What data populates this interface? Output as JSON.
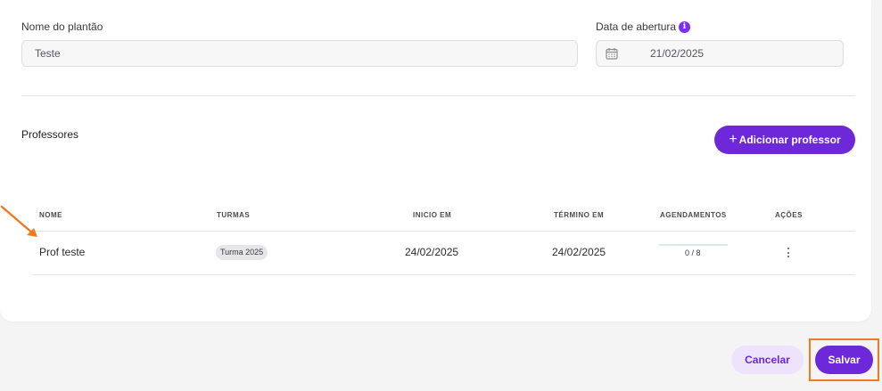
{
  "form": {
    "name_label": "Nome do plantão",
    "name_value": "Teste",
    "date_label": "Data de abertura",
    "date_info_icon": "i",
    "date_value": "21/02/2025"
  },
  "professors": {
    "section_title": "Professores",
    "add_button_icon": "+",
    "add_button_label": "Adicionar professor",
    "columns": [
      "NOME",
      "TURMAS",
      "INICIO EM",
      "TÉRMINO EM",
      "AGENDAMENTOS",
      "AÇÕES"
    ],
    "rows": [
      {
        "name": "Prof teste",
        "turma": "Turma 2025",
        "inicio": "24/02/2025",
        "termino": "24/02/2025",
        "agendamentos": "0 / 8",
        "agendamentos_fraction": 0
      }
    ]
  },
  "footer": {
    "cancel_label": "Cancelar",
    "save_label": "Salvar"
  },
  "colors": {
    "accent": "#6d28d9",
    "accent_light": "#ede3fd",
    "annotation": "#f07a24"
  },
  "icons": {
    "date_info": "info-icon",
    "calendar": "calendar-icon",
    "add": "plus-icon",
    "actions": "kebab-menu-icon",
    "annotation": "arrow-icon"
  }
}
